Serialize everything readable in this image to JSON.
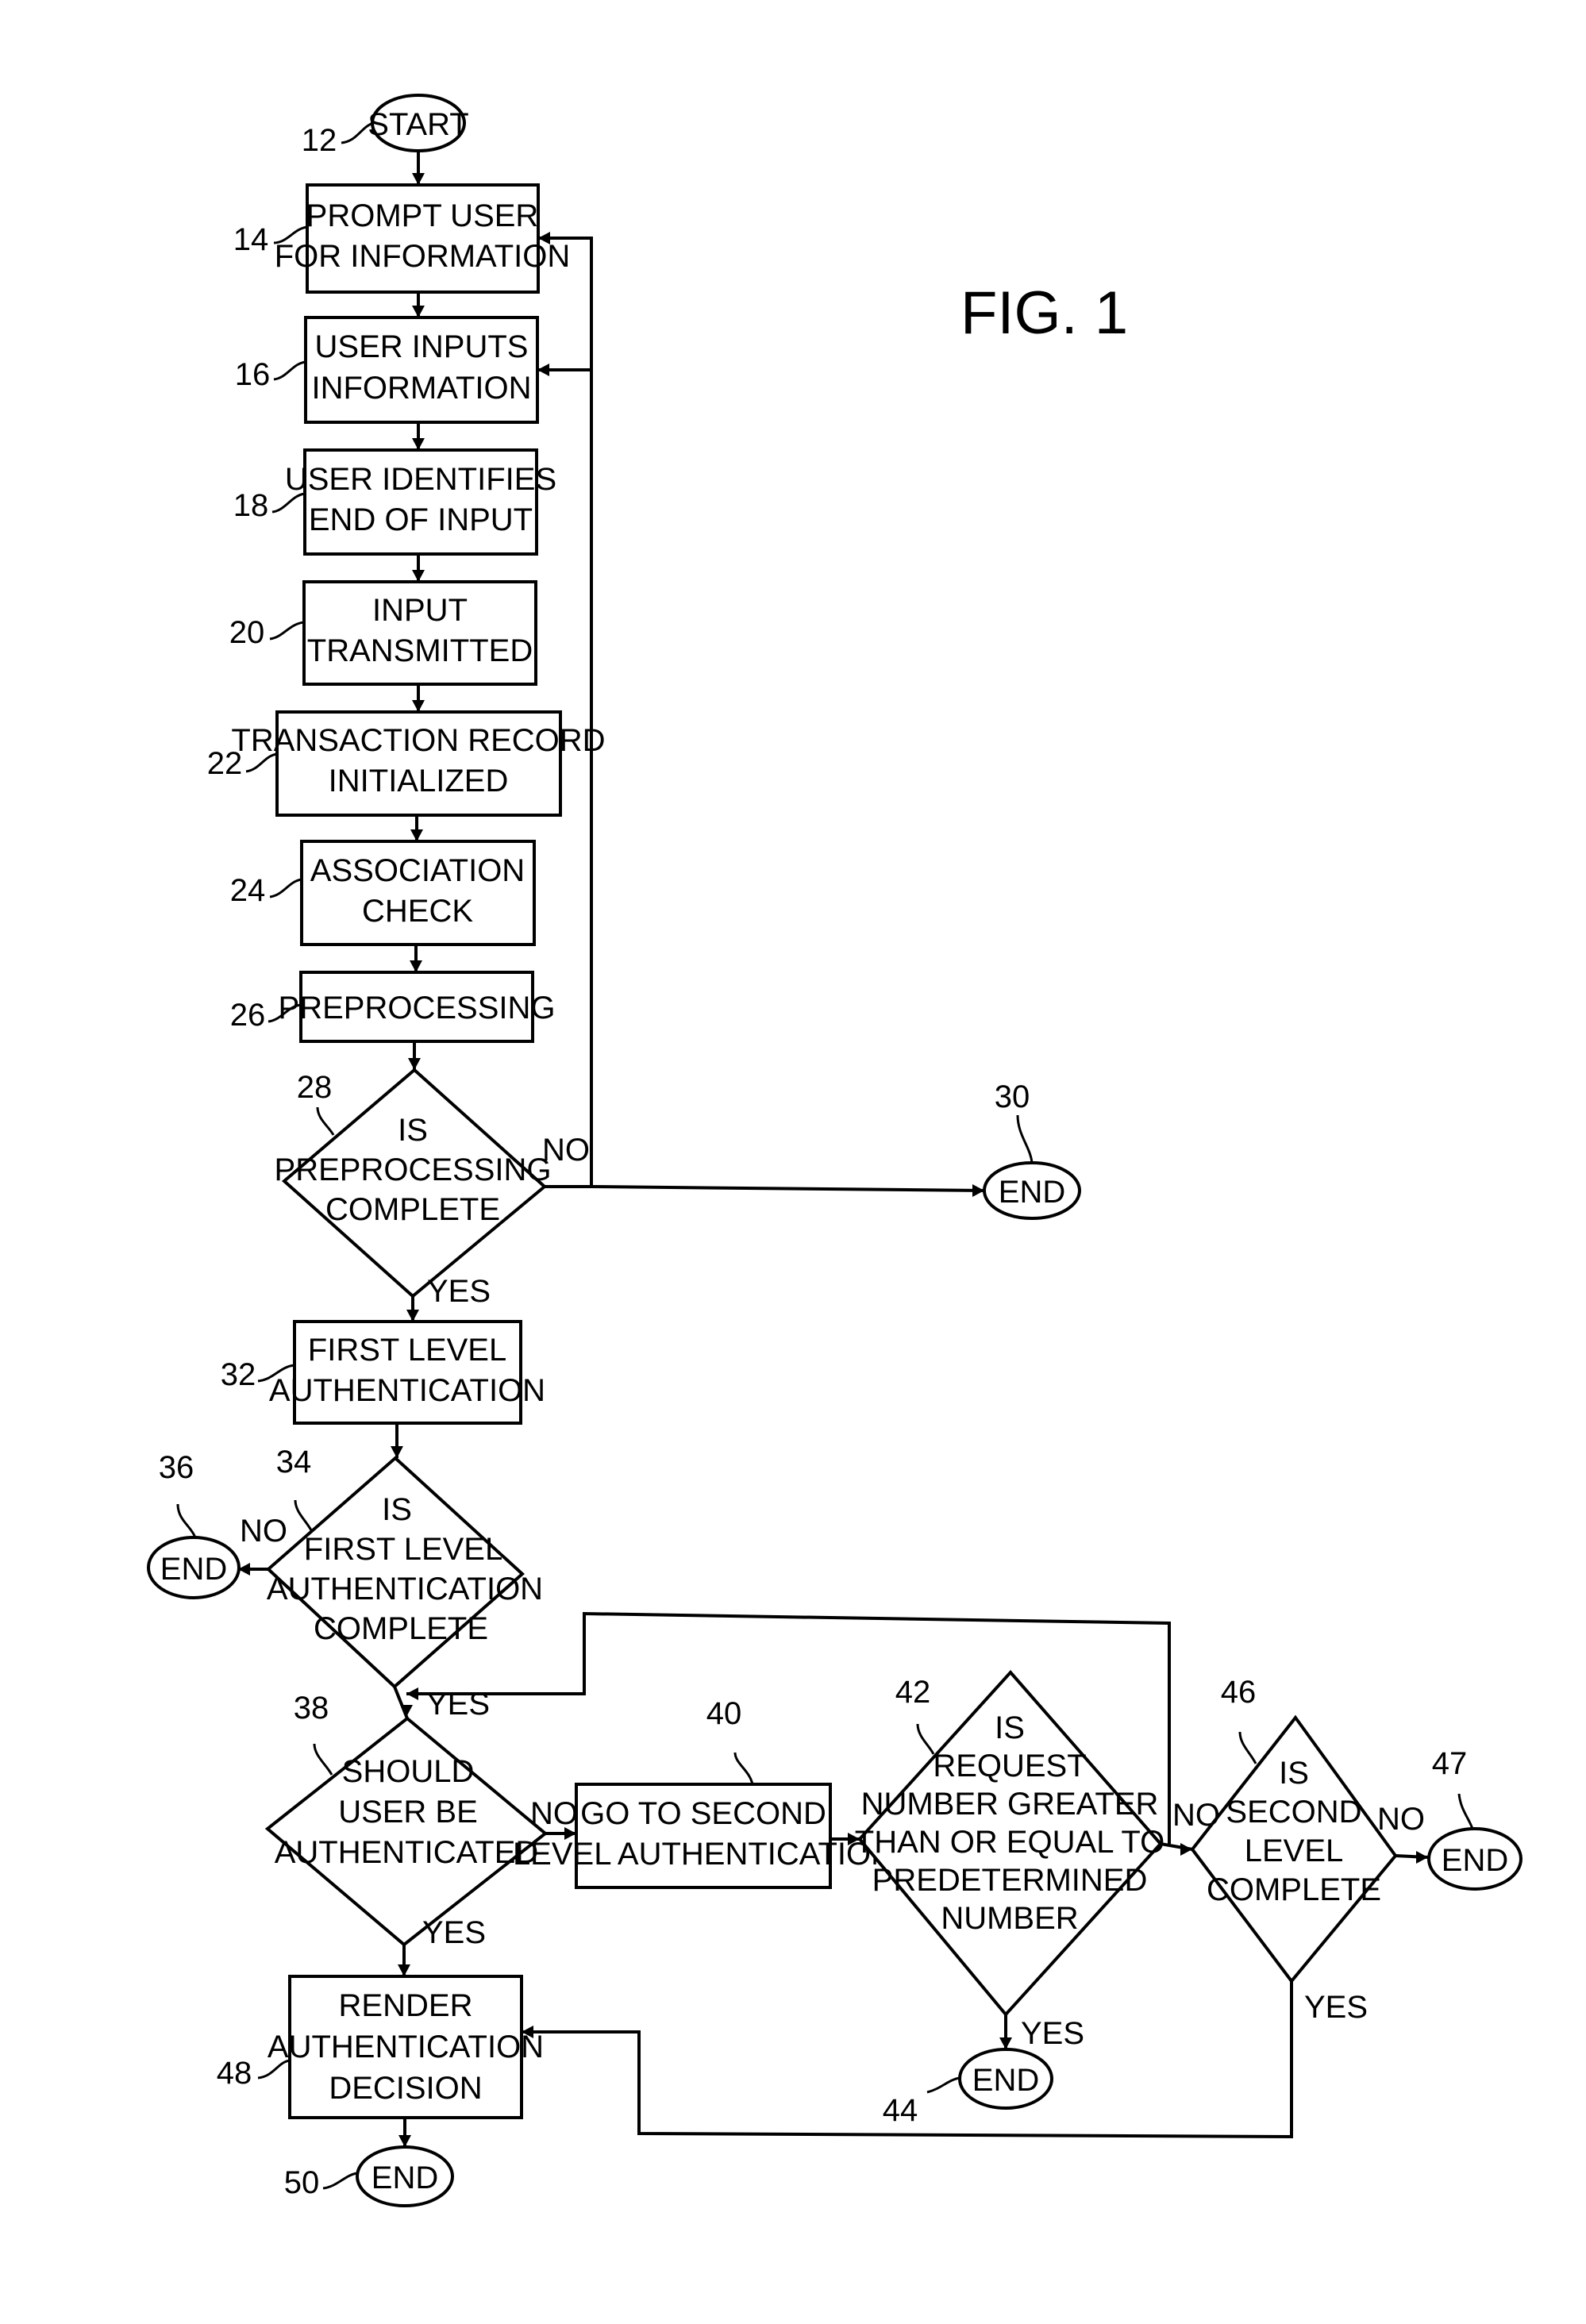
{
  "figure": {
    "title": "FIG. 1"
  },
  "nodes": {
    "n12": {
      "ref": "12",
      "type": "terminal",
      "lines": [
        "START"
      ]
    },
    "n14": {
      "ref": "14",
      "type": "process",
      "lines": [
        "PROMPT USER",
        "FOR INFORMATION"
      ]
    },
    "n16": {
      "ref": "16",
      "type": "process",
      "lines": [
        "USER INPUTS",
        "INFORMATION"
      ]
    },
    "n18": {
      "ref": "18",
      "type": "process",
      "lines": [
        "USER IDENTIFIES",
        "END OF INPUT"
      ]
    },
    "n20": {
      "ref": "20",
      "type": "process",
      "lines": [
        "INPUT",
        "TRANSMITTED"
      ]
    },
    "n22": {
      "ref": "22",
      "type": "process",
      "lines": [
        "TRANSACTION RECORD",
        "INITIALIZED"
      ]
    },
    "n24": {
      "ref": "24",
      "type": "process",
      "lines": [
        "ASSOCIATION",
        "CHECK"
      ]
    },
    "n26": {
      "ref": "26",
      "type": "process",
      "lines": [
        "PREPROCESSING"
      ]
    },
    "n28": {
      "ref": "28",
      "type": "decision",
      "lines": [
        "IS",
        "PREPROCESSING",
        "COMPLETE"
      ]
    },
    "n30": {
      "ref": "30",
      "type": "terminal",
      "lines": [
        "END"
      ]
    },
    "n32": {
      "ref": "32",
      "type": "process",
      "lines": [
        "FIRST LEVEL",
        "AUTHENTICATION"
      ]
    },
    "n34": {
      "ref": "34",
      "type": "decision",
      "lines": [
        "IS",
        "FIRST LEVEL",
        "AUTHENTICATION",
        "COMPLETE"
      ]
    },
    "n36": {
      "ref": "36",
      "type": "terminal",
      "lines": [
        "END"
      ]
    },
    "n38": {
      "ref": "38",
      "type": "decision",
      "lines": [
        "SHOULD",
        "USER BE",
        "AUTHENTICATED"
      ]
    },
    "n40": {
      "ref": "40",
      "type": "process",
      "lines": [
        "GO TO SECOND",
        "LEVEL AUTHENTICATION"
      ]
    },
    "n42": {
      "ref": "42",
      "type": "decision",
      "lines": [
        "IS",
        "REQUEST",
        "NUMBER GREATER",
        "THAN OR EQUAL TO",
        "PREDETERMINED",
        "NUMBER"
      ]
    },
    "n44": {
      "ref": "44",
      "type": "terminal",
      "lines": [
        "END"
      ]
    },
    "n46": {
      "ref": "46",
      "type": "decision",
      "lines": [
        "IS",
        "SECOND",
        "LEVEL",
        "COMPLETE"
      ]
    },
    "n47": {
      "ref": "47",
      "type": "terminal",
      "lines": [
        "END"
      ]
    },
    "n48": {
      "ref": "48",
      "type": "process",
      "lines": [
        "RENDER",
        "AUTHENTICATION",
        "DECISION"
      ]
    },
    "n50": {
      "ref": "50",
      "type": "terminal",
      "lines": [
        "END"
      ]
    }
  },
  "branches": {
    "b28_no": "NO",
    "b28_yes": "YES",
    "b34_no": "NO",
    "b34_yes": "YES",
    "b38_no": "NO",
    "b38_yes": "YES",
    "b42_no": "NO",
    "b42_yes": "YES",
    "b46_no": "NO",
    "b46_yes": "YES"
  }
}
